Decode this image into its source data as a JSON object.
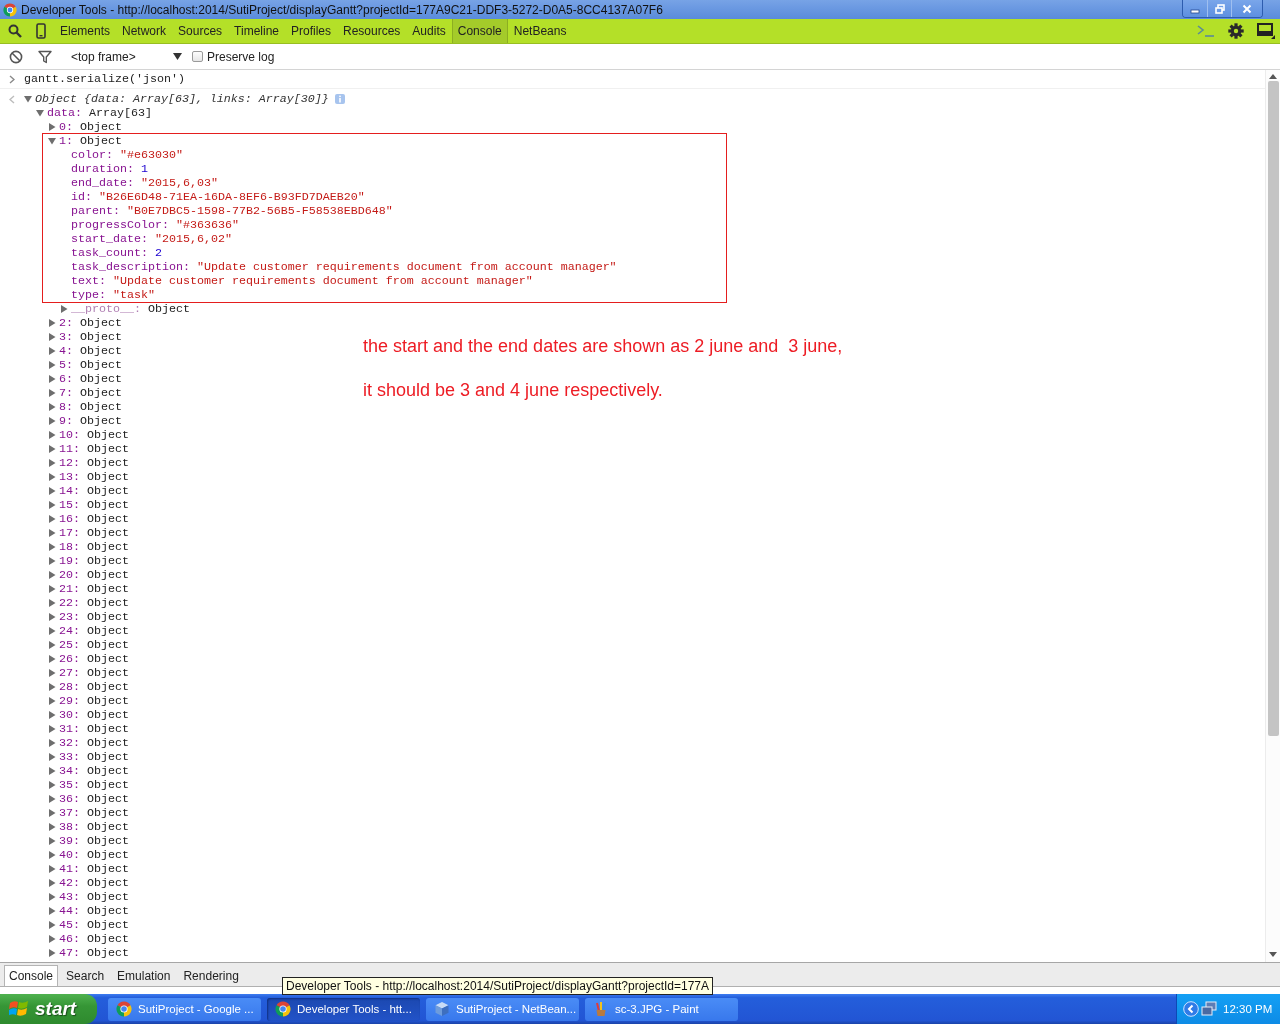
{
  "window": {
    "title": "Developer Tools - http://localhost:2014/SutiProject/displayGantt?projectId=177A9C21-DDF3-5272-D0A5-8CC4137A07F6"
  },
  "panel_tabs": [
    {
      "label": "Elements",
      "selected": false
    },
    {
      "label": "Network",
      "selected": false
    },
    {
      "label": "Sources",
      "selected": false
    },
    {
      "label": "Timeline",
      "selected": false
    },
    {
      "label": "Profiles",
      "selected": false
    },
    {
      "label": "Resources",
      "selected": false
    },
    {
      "label": "Audits",
      "selected": false
    },
    {
      "label": "Console",
      "selected": true
    },
    {
      "label": "NetBeans",
      "selected": false
    }
  ],
  "console_toolbar": {
    "frame_selector": {
      "value": "<top frame>"
    },
    "preserve_log": {
      "label": "Preserve log",
      "checked": false
    }
  },
  "console": {
    "command": "gantt.serialize('json')",
    "result": {
      "summary": "Object {data: Array[63], links: Array[30]}",
      "expanded": true,
      "children": [
        {
          "key": "data:",
          "value": "Array[63]",
          "kind": "object",
          "expanded": true,
          "children": [
            {
              "key": "0:",
              "value": "Object",
              "kind": "object",
              "expanded": false,
              "highlighted": false
            },
            {
              "key": "1:",
              "value": "Object",
              "kind": "object",
              "expanded": true,
              "highlighted": true,
              "children": [
                {
                  "key": "color:",
                  "value": "\"#e63030\"",
                  "kind": "string"
                },
                {
                  "key": "duration:",
                  "value": "1",
                  "kind": "number"
                },
                {
                  "key": "end_date:",
                  "value": "\"2015,6,03\"",
                  "kind": "string"
                },
                {
                  "key": "id:",
                  "value": "\"B26E6D48-71EA-16DA-8EF6-B93FD7DAEB20\"",
                  "kind": "string"
                },
                {
                  "key": "parent:",
                  "value": "\"B0E7DBC5-1598-77B2-56B5-F58538EBD648\"",
                  "kind": "string"
                },
                {
                  "key": "progressColor:",
                  "value": "\"#363636\"",
                  "kind": "string"
                },
                {
                  "key": "start_date:",
                  "value": "\"2015,6,02\"",
                  "kind": "string"
                },
                {
                  "key": "task_count:",
                  "value": "2",
                  "kind": "number"
                },
                {
                  "key": "task_description:",
                  "value": "\"Update customer requirements document from account manager\"",
                  "kind": "string"
                },
                {
                  "key": "text:",
                  "value": "\"Update customer requirements document from account manager\"",
                  "kind": "string"
                },
                {
                  "key": "type:",
                  "value": "\"task\"",
                  "kind": "string"
                },
                {
                  "key": "__proto__:",
                  "value": "Object",
                  "kind": "proto",
                  "expanded": false
                }
              ]
            },
            {
              "key": "2:",
              "value": "Object",
              "kind": "object",
              "expanded": false,
              "highlighted": false
            },
            {
              "key": "3:",
              "value": "Object",
              "kind": "object",
              "expanded": false,
              "highlighted": false
            },
            {
              "key": "4:",
              "value": "Object",
              "kind": "object",
              "expanded": false,
              "highlighted": false
            },
            {
              "key": "5:",
              "value": "Object",
              "kind": "object",
              "expanded": false,
              "highlighted": false
            },
            {
              "key": "6:",
              "value": "Object",
              "kind": "object",
              "expanded": false,
              "highlighted": false
            },
            {
              "key": "7:",
              "value": "Object",
              "kind": "object",
              "expanded": false,
              "highlighted": false
            },
            {
              "key": "8:",
              "value": "Object",
              "kind": "object",
              "expanded": false,
              "highlighted": false
            },
            {
              "key": "9:",
              "value": "Object",
              "kind": "object",
              "expanded": false,
              "highlighted": false
            },
            {
              "key": "10:",
              "value": "Object",
              "kind": "object",
              "expanded": false,
              "highlighted": false
            },
            {
              "key": "11:",
              "value": "Object",
              "kind": "object",
              "expanded": false,
              "highlighted": false
            },
            {
              "key": "12:",
              "value": "Object",
              "kind": "object",
              "expanded": false,
              "highlighted": false
            },
            {
              "key": "13:",
              "value": "Object",
              "kind": "object",
              "expanded": false,
              "highlighted": false
            },
            {
              "key": "14:",
              "value": "Object",
              "kind": "object",
              "expanded": false,
              "highlighted": false
            },
            {
              "key": "15:",
              "value": "Object",
              "kind": "object",
              "expanded": false,
              "highlighted": false
            },
            {
              "key": "16:",
              "value": "Object",
              "kind": "object",
              "expanded": false,
              "highlighted": false
            },
            {
              "key": "17:",
              "value": "Object",
              "kind": "object",
              "expanded": false,
              "highlighted": false
            },
            {
              "key": "18:",
              "value": "Object",
              "kind": "object",
              "expanded": false,
              "highlighted": false
            },
            {
              "key": "19:",
              "value": "Object",
              "kind": "object",
              "expanded": false,
              "highlighted": false
            },
            {
              "key": "20:",
              "value": "Object",
              "kind": "object",
              "expanded": false,
              "highlighted": false
            },
            {
              "key": "21:",
              "value": "Object",
              "kind": "object",
              "expanded": false,
              "highlighted": false
            },
            {
              "key": "22:",
              "value": "Object",
              "kind": "object",
              "expanded": false,
              "highlighted": false
            },
            {
              "key": "23:",
              "value": "Object",
              "kind": "object",
              "expanded": false,
              "highlighted": false
            },
            {
              "key": "24:",
              "value": "Object",
              "kind": "object",
              "expanded": false,
              "highlighted": false
            },
            {
              "key": "25:",
              "value": "Object",
              "kind": "object",
              "expanded": false,
              "highlighted": false
            },
            {
              "key": "26:",
              "value": "Object",
              "kind": "object",
              "expanded": false,
              "highlighted": false
            },
            {
              "key": "27:",
              "value": "Object",
              "kind": "object",
              "expanded": false,
              "highlighted": false
            },
            {
              "key": "28:",
              "value": "Object",
              "kind": "object",
              "expanded": false,
              "highlighted": false
            },
            {
              "key": "29:",
              "value": "Object",
              "kind": "object",
              "expanded": false,
              "highlighted": false
            },
            {
              "key": "30:",
              "value": "Object",
              "kind": "object",
              "expanded": false,
              "highlighted": false
            },
            {
              "key": "31:",
              "value": "Object",
              "kind": "object",
              "expanded": false,
              "highlighted": false
            },
            {
              "key": "32:",
              "value": "Object",
              "kind": "object",
              "expanded": false,
              "highlighted": false
            },
            {
              "key": "33:",
              "value": "Object",
              "kind": "object",
              "expanded": false,
              "highlighted": false
            },
            {
              "key": "34:",
              "value": "Object",
              "kind": "object",
              "expanded": false,
              "highlighted": false
            },
            {
              "key": "35:",
              "value": "Object",
              "kind": "object",
              "expanded": false,
              "highlighted": false
            },
            {
              "key": "36:",
              "value": "Object",
              "kind": "object",
              "expanded": false,
              "highlighted": false
            },
            {
              "key": "37:",
              "value": "Object",
              "kind": "object",
              "expanded": false,
              "highlighted": false
            },
            {
              "key": "38:",
              "value": "Object",
              "kind": "object",
              "expanded": false,
              "highlighted": false
            },
            {
              "key": "39:",
              "value": "Object",
              "kind": "object",
              "expanded": false,
              "highlighted": false
            },
            {
              "key": "40:",
              "value": "Object",
              "kind": "object",
              "expanded": false,
              "highlighted": false
            },
            {
              "key": "41:",
              "value": "Object",
              "kind": "object",
              "expanded": false,
              "highlighted": false
            },
            {
              "key": "42:",
              "value": "Object",
              "kind": "object",
              "expanded": false,
              "highlighted": false
            },
            {
              "key": "43:",
              "value": "Object",
              "kind": "object",
              "expanded": false,
              "highlighted": false
            },
            {
              "key": "44:",
              "value": "Object",
              "kind": "object",
              "expanded": false,
              "highlighted": false
            },
            {
              "key": "45:",
              "value": "Object",
              "kind": "object",
              "expanded": false,
              "highlighted": false
            },
            {
              "key": "46:",
              "value": "Object",
              "kind": "object",
              "expanded": false,
              "highlighted": false
            },
            {
              "key": "47:",
              "value": "Object",
              "kind": "object",
              "expanded": false,
              "highlighted": false
            }
          ]
        }
      ]
    }
  },
  "annotation": {
    "lines": [
      "the start and the end dates are shown as 2 june and  3 june,",
      "it should be 3 and 4 june respectively."
    ]
  },
  "drawer_tabs": [
    {
      "label": "Console",
      "selected": true
    },
    {
      "label": "Search",
      "selected": false
    },
    {
      "label": "Emulation",
      "selected": false
    },
    {
      "label": "Rendering",
      "selected": false
    }
  ],
  "tooltip": {
    "text": "Developer Tools - http://localhost:2014/SutiProject/displayGantt?projectId=177A"
  },
  "taskbar": {
    "start_label": "start",
    "tasks": [
      {
        "label": "SutiProject - Google ...",
        "kind": "browser",
        "selected": false
      },
      {
        "label": "Developer Tools - htt...",
        "kind": "browser",
        "selected": true
      },
      {
        "label": "SutiProject - NetBean...",
        "kind": "ide",
        "selected": false
      },
      {
        "label": "sc-3.JPG - Paint",
        "kind": "image-editor",
        "selected": false
      }
    ],
    "clock": "12:30 PM"
  }
}
